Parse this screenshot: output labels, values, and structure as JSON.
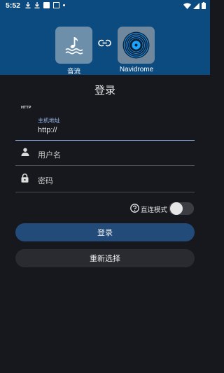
{
  "status_bar": {
    "time": "5:52"
  },
  "header": {
    "left_app_label": "音流",
    "right_app_label": "Navidrome"
  },
  "page_title": "登录",
  "form": {
    "host": {
      "badge": "HTTP",
      "label": "主机地址",
      "value": "http://"
    },
    "username": {
      "placeholder": "用户名"
    },
    "password": {
      "placeholder": "密码"
    },
    "direct_mode": {
      "label": "直连模式",
      "enabled": false
    }
  },
  "buttons": {
    "login": "登录",
    "reselect": "重新选择"
  },
  "colors": {
    "header_bg": "#0c4b7f",
    "page_bg": "#17181d",
    "primary_button": "#234b7a",
    "secondary_button": "#2a2b31",
    "accent": "#90b4e8"
  },
  "icons": {
    "left_tile": "music-waves-icon",
    "right_tile": "vinyl-disc-icon",
    "link": "link-icon",
    "user": "person-icon",
    "password": "lock-icon",
    "help": "help-circle-icon"
  }
}
